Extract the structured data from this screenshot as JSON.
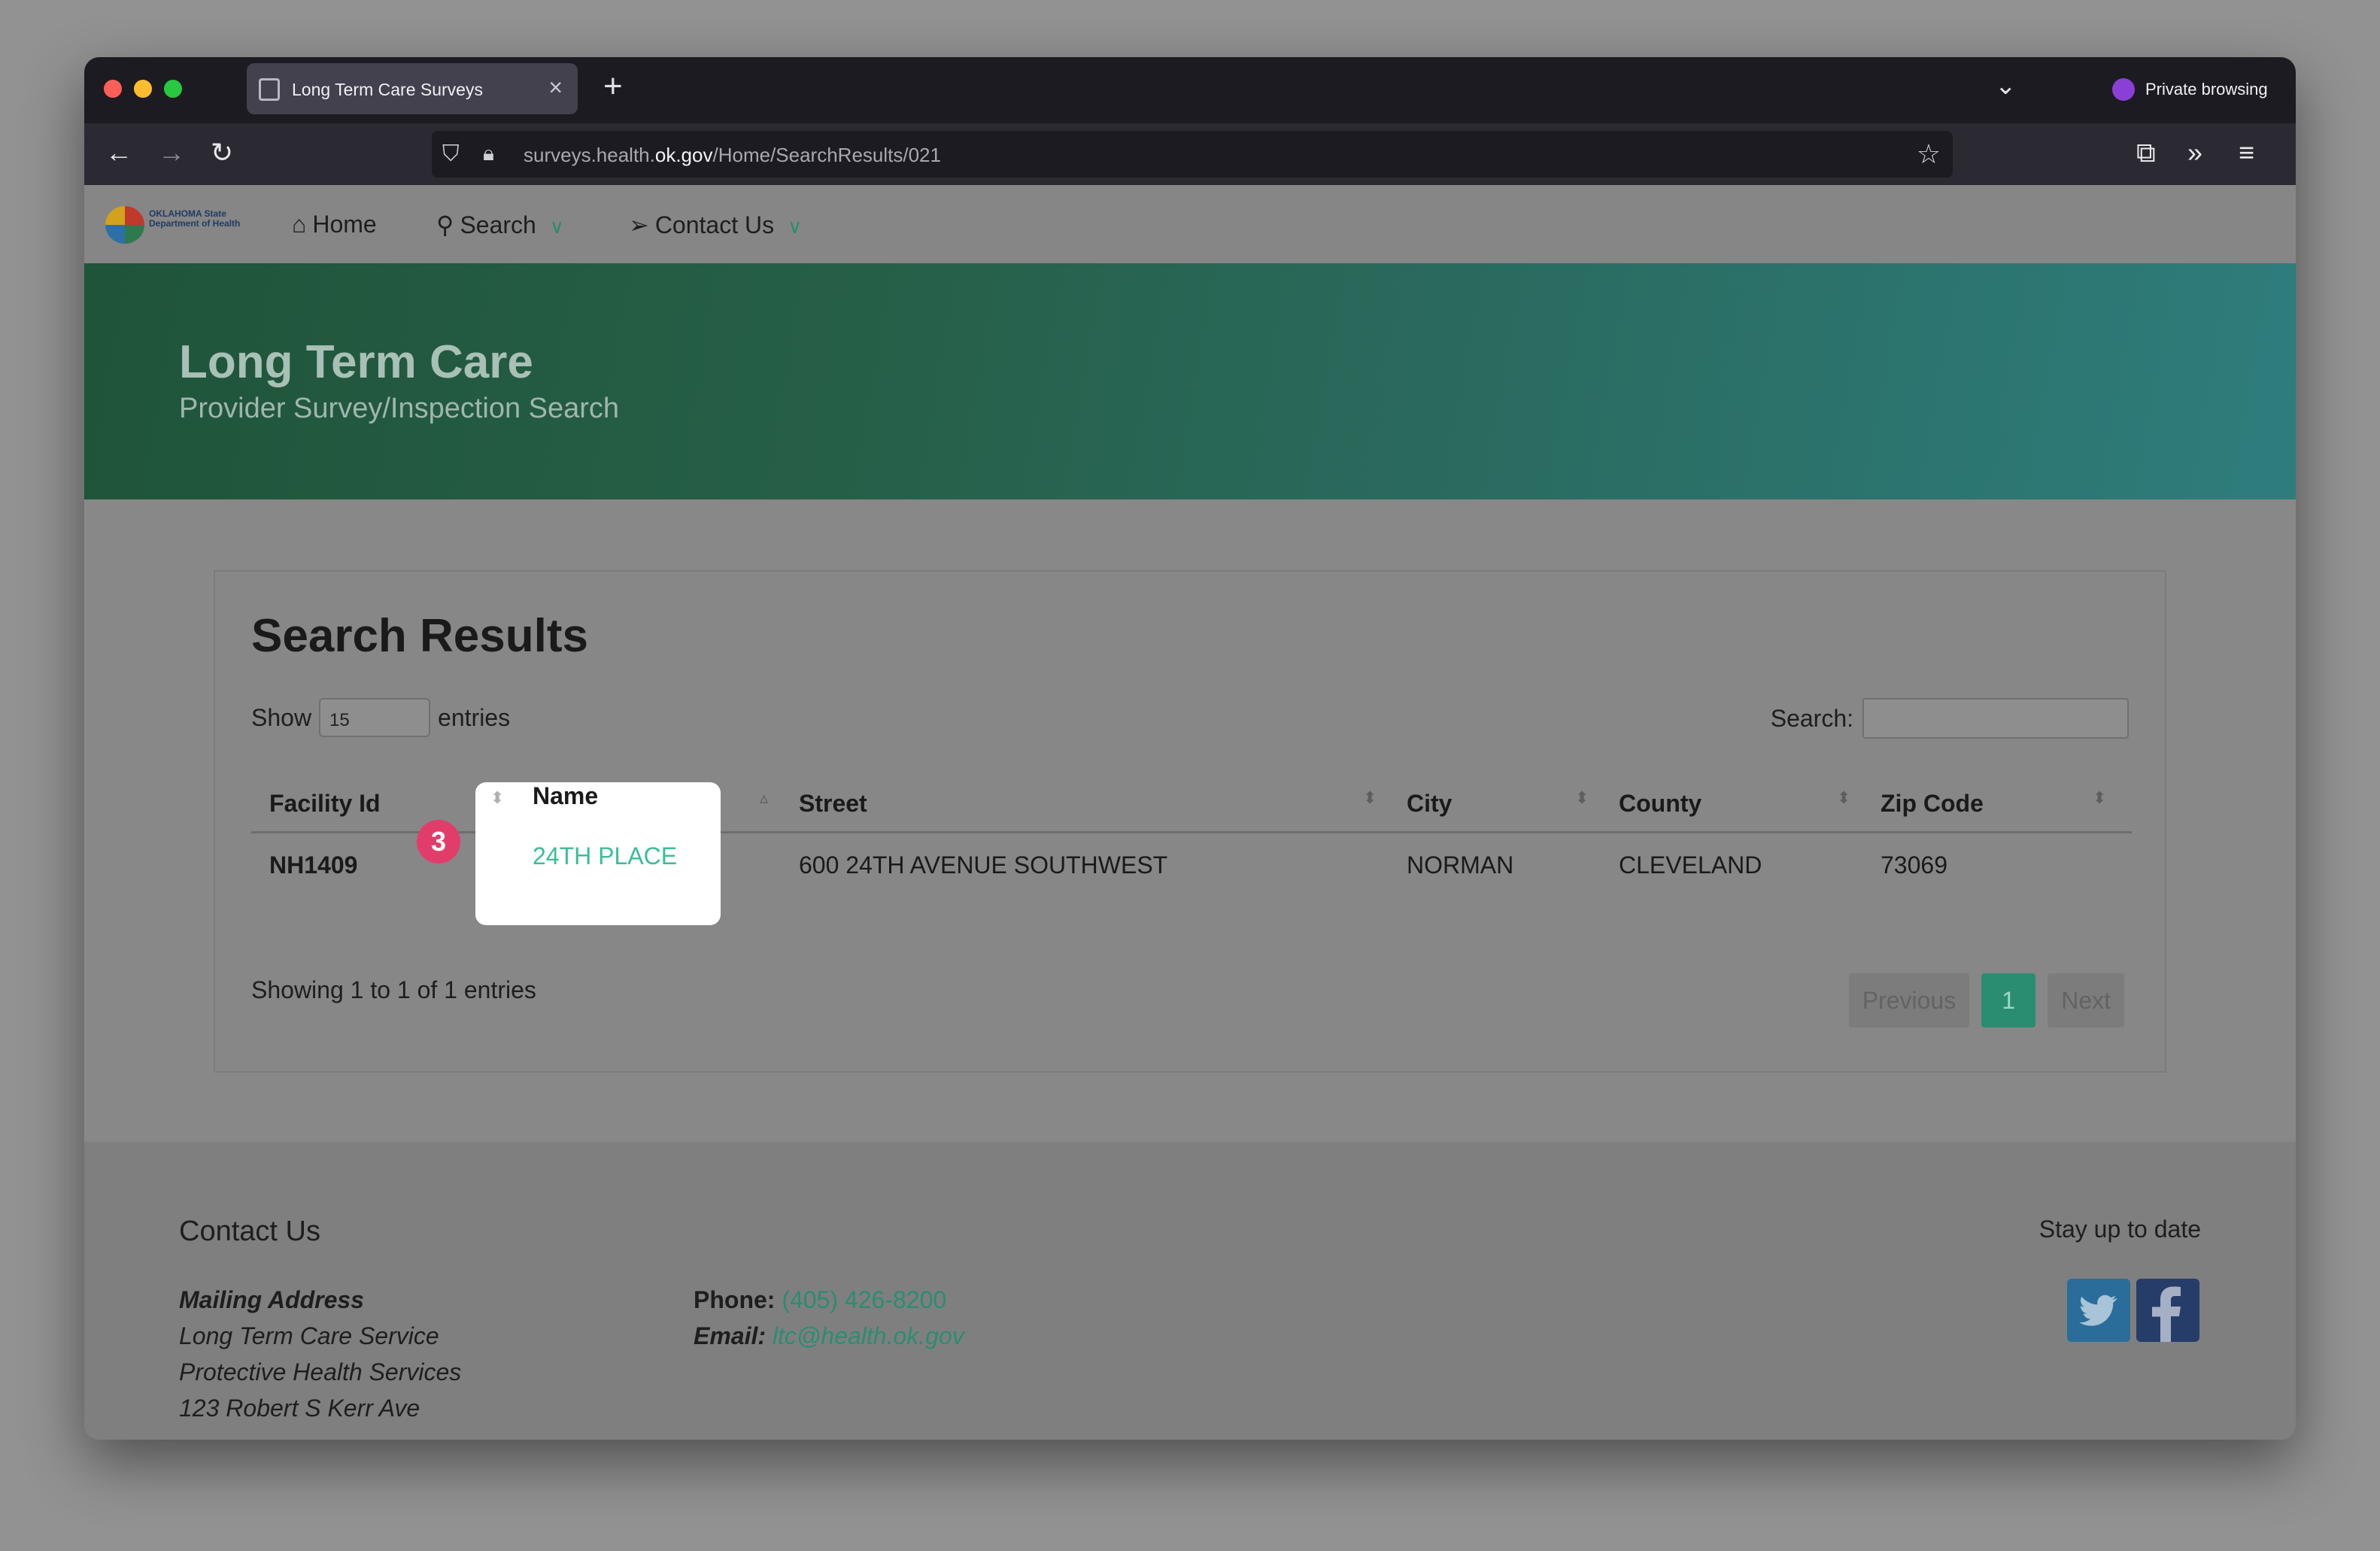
{
  "browser": {
    "tab_title": "Long Term Care Surveys",
    "tab_close": "×",
    "new_tab": "+",
    "private_label": "Private browsing",
    "url_prefix": "surveys.health.",
    "url_domain": "ok.gov",
    "url_path": "/Home/SearchResults/021"
  },
  "site_nav": {
    "logo_text": "OKLAHOMA State Department of Health",
    "items": [
      {
        "label": "Home",
        "icon": "home-icon"
      },
      {
        "label": "Search",
        "icon": "search-icon"
      },
      {
        "label": "Contact Us",
        "icon": "send-icon"
      }
    ]
  },
  "hero": {
    "title": "Long Term Care",
    "subtitle": "Provider Survey/Inspection Search"
  },
  "results": {
    "title": "Search Results",
    "show_label": "Show",
    "show_value": "15",
    "entries_label": "entries",
    "search_label": "Search:",
    "columns": [
      "Facility Id",
      "Name",
      "Street",
      "City",
      "County",
      "Zip Code"
    ],
    "rows": [
      {
        "facility_id": "NH1409",
        "name": "24TH PLACE",
        "street": "600 24TH AVENUE SOUTHWEST",
        "city": "NORMAN",
        "county": "CLEVELAND",
        "zip": "73069"
      }
    ],
    "info": "Showing 1 to 1 of 1 entries",
    "pager": {
      "previous": "Previous",
      "current": "1",
      "next": "Next"
    },
    "step_badge": "3"
  },
  "footer": {
    "title": "Contact Us",
    "mailing_label": "Mailing Address",
    "address_lines": [
      "Long Term Care Service",
      "Protective Health Services",
      "123 Robert S Kerr Ave"
    ],
    "phone_label": "Phone:",
    "phone": "(405) 426-8200",
    "email_label": "Email:",
    "email": "ltc@health.ok.gov",
    "stay_label": "Stay up to date"
  },
  "colors": {
    "accent": "#2a8d72",
    "link_highlight": "#3bbd9a",
    "badge": "#e23c6b"
  }
}
